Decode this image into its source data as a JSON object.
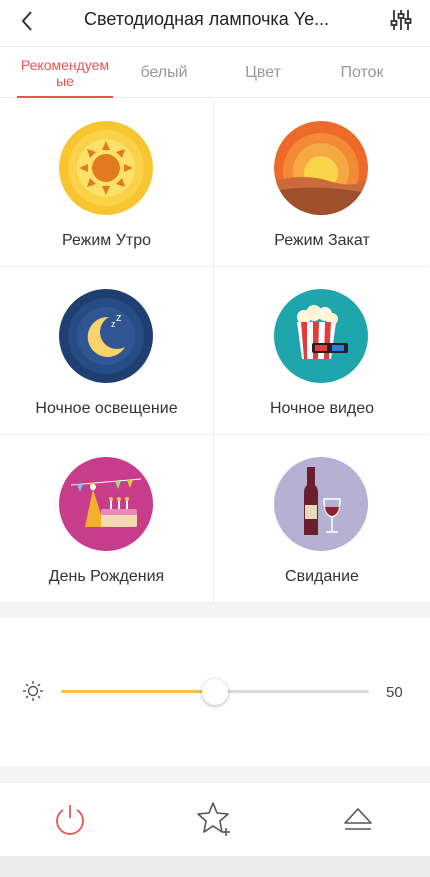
{
  "header": {
    "title": "Светодиодная лампочка Ye...",
    "back_icon": "chevron-left-icon",
    "settings_icon": "sliders-icon"
  },
  "tabs": [
    {
      "label": "Рекомендуем ые",
      "active": true
    },
    {
      "label": "белый",
      "active": false
    },
    {
      "label": "Цвет",
      "active": false
    },
    {
      "label": "Поток",
      "active": false
    }
  ],
  "scenes": [
    {
      "label": "Режим Утро",
      "icon": "sun-morning-icon"
    },
    {
      "label": "Режим Закат",
      "icon": "sunset-icon"
    },
    {
      "label": "Ночное освещение",
      "icon": "moon-sleep-icon"
    },
    {
      "label": "Ночное видео",
      "icon": "popcorn-3d-glasses-icon"
    },
    {
      "label": "День Рождения",
      "icon": "birthday-party-icon"
    },
    {
      "label": "Свидание",
      "icon": "wine-date-icon"
    }
  ],
  "brightness": {
    "value": "50",
    "level": 0.5,
    "icon": "brightness-sun-icon"
  },
  "bottom_bar": {
    "power_icon": "power-icon",
    "favorite_icon": "star-add-icon",
    "eject_icon": "eject-icon"
  },
  "colors": {
    "accent": "#e8554e",
    "slider_fill": "#f2c34a",
    "slider_track": "#d9dce4"
  }
}
